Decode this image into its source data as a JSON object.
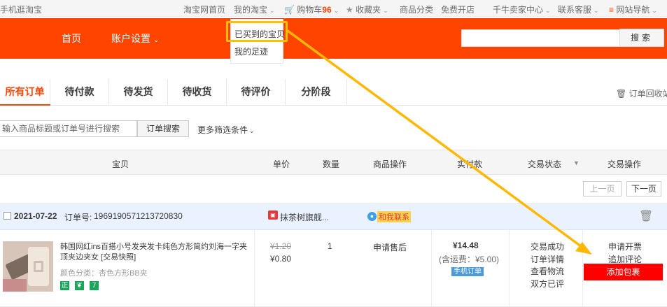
{
  "topbar": {
    "mobile_taobao": "手机逛淘宝",
    "taobao_home": "淘宝网首页",
    "my_taobao": "我的淘宝",
    "cart_label": "购物车",
    "cart_count": "96",
    "favorites": "收藏夹",
    "categories": "商品分类",
    "open_shop": "免费开店",
    "seller_center": "千牛卖家中心",
    "customer_service": "联系客服",
    "site_nav": "网站导航"
  },
  "header": {
    "home": "首页",
    "account_settings": "账户设置",
    "search_button": "搜索"
  },
  "dropdown": {
    "bought_items": "已买到的宝贝",
    "my_footprints": "我的足迹"
  },
  "tabs": [
    "所有订单",
    "待付款",
    "待发货",
    "待收货",
    "待评价",
    "分阶段"
  ],
  "recycle_bin": "订单回收站",
  "order_search": {
    "placeholder": "输入商品标题或订单号进行搜索",
    "button": "订单搜索",
    "more_filters": "更多筛选条件"
  },
  "table_header": {
    "item": "宝贝",
    "unit_price": "单价",
    "quantity": "数量",
    "item_ops": "商品操作",
    "paid": "实付款",
    "trade_status": "交易状态",
    "trade_ops": "交易操作"
  },
  "pagination": {
    "prev": "上一页",
    "next": "下一页"
  },
  "order": {
    "date": "2021-07-22",
    "order_no_label": "订单号:",
    "order_no": "1969190571213720830",
    "shop_name": "抹茶树旗舰...",
    "contact_label": "和我联系",
    "title": "韩国网红ins百搭小号发夹发卡纯色方形简约刘海一字夹顶夹边夹女 [交易快照]",
    "spec": "颜色分类：杏色方形BB夹",
    "original_price": "¥1.20",
    "price": "¥0.80",
    "quantity": "1",
    "after_sale": "申请售后",
    "paid": "¥14.48",
    "shipping": "(含运费：¥5.00)",
    "mobile_order": "手机订单",
    "status": [
      "交易成功",
      "订单详情",
      "查看物流",
      "双方已评"
    ],
    "ops": [
      "申请开票",
      "追加评论"
    ],
    "add_package": "添加包裹",
    "badges": [
      "正",
      "❦",
      "7"
    ]
  },
  "colors": {
    "brand_orange": "#ff4400",
    "highlight_yellow": "#ffc000",
    "add_package_red": "#ff0000",
    "order_head_bg": "#eaf1ff"
  }
}
